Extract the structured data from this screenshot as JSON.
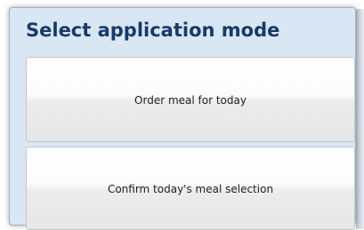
{
  "dialog": {
    "title": "Select application mode",
    "options": [
      {
        "label": "Order meal for today"
      },
      {
        "label": "Confirm today's meal selection"
      }
    ]
  },
  "colors": {
    "title_text": "#173a6a",
    "dialog_background": "#d9e6f3",
    "button_background": "#f4f4f4",
    "button_text": "#222222"
  }
}
